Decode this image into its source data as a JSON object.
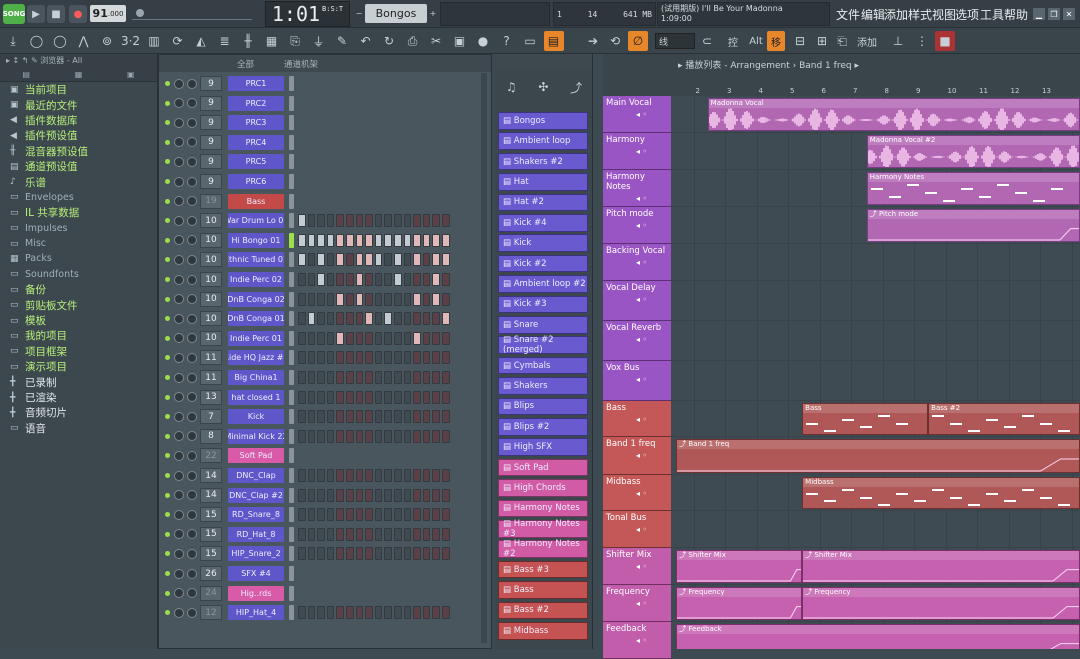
{
  "transport": {
    "mode": "SONG",
    "tempo": "91",
    "tempo_dec": ".000",
    "time": "1:01",
    "time_sub": "00",
    "time_label": "B:S:T",
    "pattern": "Bongos"
  },
  "cpu": {
    "value": "14",
    "mem": "641 MB",
    "bar": "1"
  },
  "hint": {
    "title": "(试用期版) I'll Be Your Madonna",
    "time": "1:09:00"
  },
  "menu": [
    "文件",
    "编辑",
    "添加",
    "样式",
    "视图",
    "选项",
    "工具",
    "帮助"
  ],
  "toolbar": {
    "snap": "线",
    "labels": [
      "控",
      "Alt",
      "移"
    ],
    "add": "添加"
  },
  "browser": {
    "title": "浏览器 - All",
    "items": [
      {
        "label": "当前项目",
        "c": "g",
        "ic": "▣"
      },
      {
        "label": "最近的文件",
        "c": "g",
        "ic": "▣"
      },
      {
        "label": "插件数据库",
        "c": "g",
        "ic": "◀"
      },
      {
        "label": "插件预设值",
        "c": "g",
        "ic": "◀"
      },
      {
        "label": "混音器预设值",
        "c": "g",
        "ic": "╫"
      },
      {
        "label": "通道预设值",
        "c": "g",
        "ic": "▤"
      },
      {
        "label": "乐谱",
        "c": "g",
        "ic": "♪"
      },
      {
        "label": "Envelopes",
        "c": "grey",
        "ic": "▭"
      },
      {
        "label": "IL 共享数据",
        "c": "g",
        "ic": "▭"
      },
      {
        "label": "Impulses",
        "c": "grey",
        "ic": "▭"
      },
      {
        "label": "Misc",
        "c": "grey",
        "ic": "▭"
      },
      {
        "label": "Packs",
        "c": "grey",
        "ic": "▦"
      },
      {
        "label": "Soundfonts",
        "c": "grey",
        "ic": "▭"
      },
      {
        "label": "备份",
        "c": "g",
        "ic": "▭"
      },
      {
        "label": "剪贴板文件",
        "c": "g",
        "ic": "▭"
      },
      {
        "label": "模板",
        "c": "g",
        "ic": "▭"
      },
      {
        "label": "我的项目",
        "c": "g",
        "ic": "▭"
      },
      {
        "label": "项目框架",
        "c": "g",
        "ic": "▭"
      },
      {
        "label": "演示项目",
        "c": "g",
        "ic": "▭"
      },
      {
        "label": "已录制",
        "c": "w",
        "ic": "╋"
      },
      {
        "label": "已渲染",
        "c": "w",
        "ic": "╋"
      },
      {
        "label": "音频切片",
        "c": "w",
        "ic": "╋"
      },
      {
        "label": "语音",
        "c": "w",
        "ic": "▭"
      }
    ]
  },
  "rack": {
    "filter": "全部",
    "title": "通道机架",
    "channels": [
      {
        "n": "9",
        "name": "PRC1",
        "c": "b",
        "p": "",
        "sel": false
      },
      {
        "n": "9",
        "name": "PRC2",
        "c": "b",
        "p": "",
        "sel": false
      },
      {
        "n": "9",
        "name": "PRC3",
        "c": "b",
        "p": "",
        "sel": false
      },
      {
        "n": "9",
        "name": "PRC4",
        "c": "b",
        "p": "",
        "sel": false
      },
      {
        "n": "9",
        "name": "PRC5",
        "c": "b",
        "p": "",
        "sel": false
      },
      {
        "n": "9",
        "name": "PRC6",
        "c": "b",
        "p": "",
        "sel": false
      },
      {
        "n": "19",
        "name": "Bass",
        "c": "r",
        "p": "",
        "sel": false,
        "dim": true
      },
      {
        "n": "10",
        "name": "War Drum Lo 01",
        "c": "b",
        "p": "1000000000000000",
        "sel": false
      },
      {
        "n": "10",
        "name": "Hi Bongo 01",
        "c": "b",
        "p": "1111111111111111",
        "sel": true
      },
      {
        "n": "10",
        "name": "Ethnic Tuned 01",
        "c": "b",
        "p": "1010101110101011",
        "sel": false
      },
      {
        "n": "10",
        "name": "Indie Perc 02",
        "c": "b",
        "p": "0010001000100010",
        "sel": false
      },
      {
        "n": "10",
        "name": "DnB Conga 02",
        "c": "b",
        "p": "0000101000001010",
        "sel": false
      },
      {
        "n": "10",
        "name": "DnB Conga 01",
        "c": "b",
        "p": "0100000101000001",
        "sel": false
      },
      {
        "n": "10",
        "name": "Indie Perc 01",
        "c": "b",
        "p": "0000100000001000",
        "sel": false
      },
      {
        "n": "11",
        "name": "Ride HQ Jazz #3",
        "c": "b",
        "p": "0000000000000000",
        "sel": false
      },
      {
        "n": "11",
        "name": "Big China1",
        "c": "b",
        "p": "0000000000000000",
        "sel": false
      },
      {
        "n": "13",
        "name": "hat closed 1",
        "c": "b",
        "p": "0000000000000000",
        "sel": false
      },
      {
        "n": "7",
        "name": "Kick",
        "c": "b",
        "p": "0000000000000000",
        "sel": false
      },
      {
        "n": "8",
        "name": "Minimal Kick 22",
        "c": "b",
        "p": "0000000000000000",
        "sel": false
      },
      {
        "n": "22",
        "name": "Soft Pad",
        "c": "p",
        "p": "",
        "sel": false,
        "dim": true
      },
      {
        "n": "14",
        "name": "DNC_Clap",
        "c": "b",
        "p": "0000000000000000",
        "sel": false
      },
      {
        "n": "14",
        "name": "DNC_Clap #2",
        "c": "b",
        "p": "0000000000000000",
        "sel": false
      },
      {
        "n": "15",
        "name": "RD_Snare_8",
        "c": "b",
        "p": "0000000000000000",
        "sel": false
      },
      {
        "n": "15",
        "name": "RD_Hat_8",
        "c": "b",
        "p": "0000000000000000",
        "sel": false
      },
      {
        "n": "15",
        "name": "HIP_Snare_2",
        "c": "b",
        "p": "0000000000000000",
        "sel": false
      },
      {
        "n": "26",
        "name": "SFX #4",
        "c": "b",
        "p": "",
        "sel": false
      },
      {
        "n": "24",
        "name": "Hig..rds",
        "c": "p",
        "p": "",
        "sel": false,
        "dim": true
      },
      {
        "n": "12",
        "name": "HIP_Hat_4",
        "c": "b",
        "p": "0000000000000000",
        "sel": false,
        "dim": true
      }
    ]
  },
  "picker": [
    "Bongos",
    "Ambient loop",
    "Shakers #2",
    "Hat",
    "Hat #2",
    "Kick #4",
    "Kick",
    "Kick #2",
    "Ambient loop #2",
    "Kick #3",
    "Snare",
    "Snare #2 (merged)",
    "Cymbals",
    "Shakers",
    "Blips",
    "Blips #2",
    "High SFX",
    "Soft Pad",
    "High Chords",
    "Harmony Notes",
    "Harmony Notes #3",
    "Harmony Notes #2",
    "Bass #3",
    "Bass",
    "Bass #2",
    "Midbass"
  ],
  "playlist": {
    "title": "播放列表 - Arrangement",
    "crumb": "Band 1 freq",
    "bars": [
      "2",
      "3",
      "4",
      "5",
      "6",
      "7",
      "8",
      "9",
      "10",
      "11",
      "12",
      "13"
    ],
    "tracks": [
      {
        "name": "Main Vocal",
        "h": 37,
        "c": "purple"
      },
      {
        "name": "Harmony",
        "h": 37,
        "c": "purple"
      },
      {
        "name": "Harmony Notes",
        "h": 37,
        "c": "purple"
      },
      {
        "name": "Pitch mode",
        "h": 37,
        "c": "purple"
      },
      {
        "name": "Backing Vocal",
        "h": 37,
        "c": "purple"
      },
      {
        "name": "Vocal Delay",
        "h": 40,
        "c": "purple"
      },
      {
        "name": "Vocal Reverb",
        "h": 40,
        "c": "purple"
      },
      {
        "name": "Vox Bus",
        "h": 40,
        "c": "purple"
      },
      {
        "name": "Bass",
        "h": 36,
        "c": "red"
      },
      {
        "name": "Band 1 freq",
        "h": 38,
        "c": "red"
      },
      {
        "name": "Midbass",
        "h": 36,
        "c": "red"
      },
      {
        "name": "Tonal Bus",
        "h": 37,
        "c": "red"
      },
      {
        "name": "Shifter Mix",
        "h": 37,
        "c": "pink"
      },
      {
        "name": "Frequency",
        "h": 37,
        "c": "pink"
      },
      {
        "name": "Feedback",
        "h": 37,
        "c": "pink"
      }
    ],
    "clips": [
      {
        "lane": 0,
        "label": "Madonna Vocal",
        "x0": 1.45,
        "x1": 13.5,
        "c": "purple",
        "type": "wave"
      },
      {
        "lane": 1,
        "label": "Madonna Vocal #2",
        "x0": 6.5,
        "x1": 13.5,
        "c": "purple",
        "type": "wave"
      },
      {
        "lane": 2,
        "label": "Harmony Notes",
        "x0": 6.5,
        "x1": 13.5,
        "c": "purple",
        "type": "notes"
      },
      {
        "lane": 3,
        "label": "Pitch mode",
        "x0": 6.5,
        "x1": 13.5,
        "c": "purple",
        "type": "auto"
      },
      {
        "lane": 8,
        "label": "Bass",
        "x0": 4.45,
        "x1": 8.45,
        "c": "red",
        "type": "notes"
      },
      {
        "lane": 8,
        "label": "Bass #2",
        "x0": 8.45,
        "x1": 13.5,
        "c": "red",
        "type": "notes"
      },
      {
        "lane": 9,
        "label": "Band 1 freq",
        "x0": 0.45,
        "x1": 13.5,
        "c": "red",
        "type": "auto"
      },
      {
        "lane": 10,
        "label": "Midbass",
        "x0": 4.45,
        "x1": 13.5,
        "c": "red",
        "type": "notes"
      },
      {
        "lane": 12,
        "label": "Shifter Mix",
        "x0": 0.45,
        "x1": 4.45,
        "c": "pink",
        "type": "auto"
      },
      {
        "lane": 12,
        "label": "Shifter Mix",
        "x0": 4.45,
        "x1": 13.5,
        "c": "pink",
        "type": "auto"
      },
      {
        "lane": 13,
        "label": "Frequency",
        "x0": 0.45,
        "x1": 4.45,
        "c": "pink",
        "type": "auto"
      },
      {
        "lane": 13,
        "label": "Frequency",
        "x0": 4.45,
        "x1": 13.5,
        "c": "pink",
        "type": "auto"
      },
      {
        "lane": 14,
        "label": "Feedback",
        "x0": 0.45,
        "x1": 13.5,
        "c": "pink",
        "type": "auto"
      }
    ]
  }
}
